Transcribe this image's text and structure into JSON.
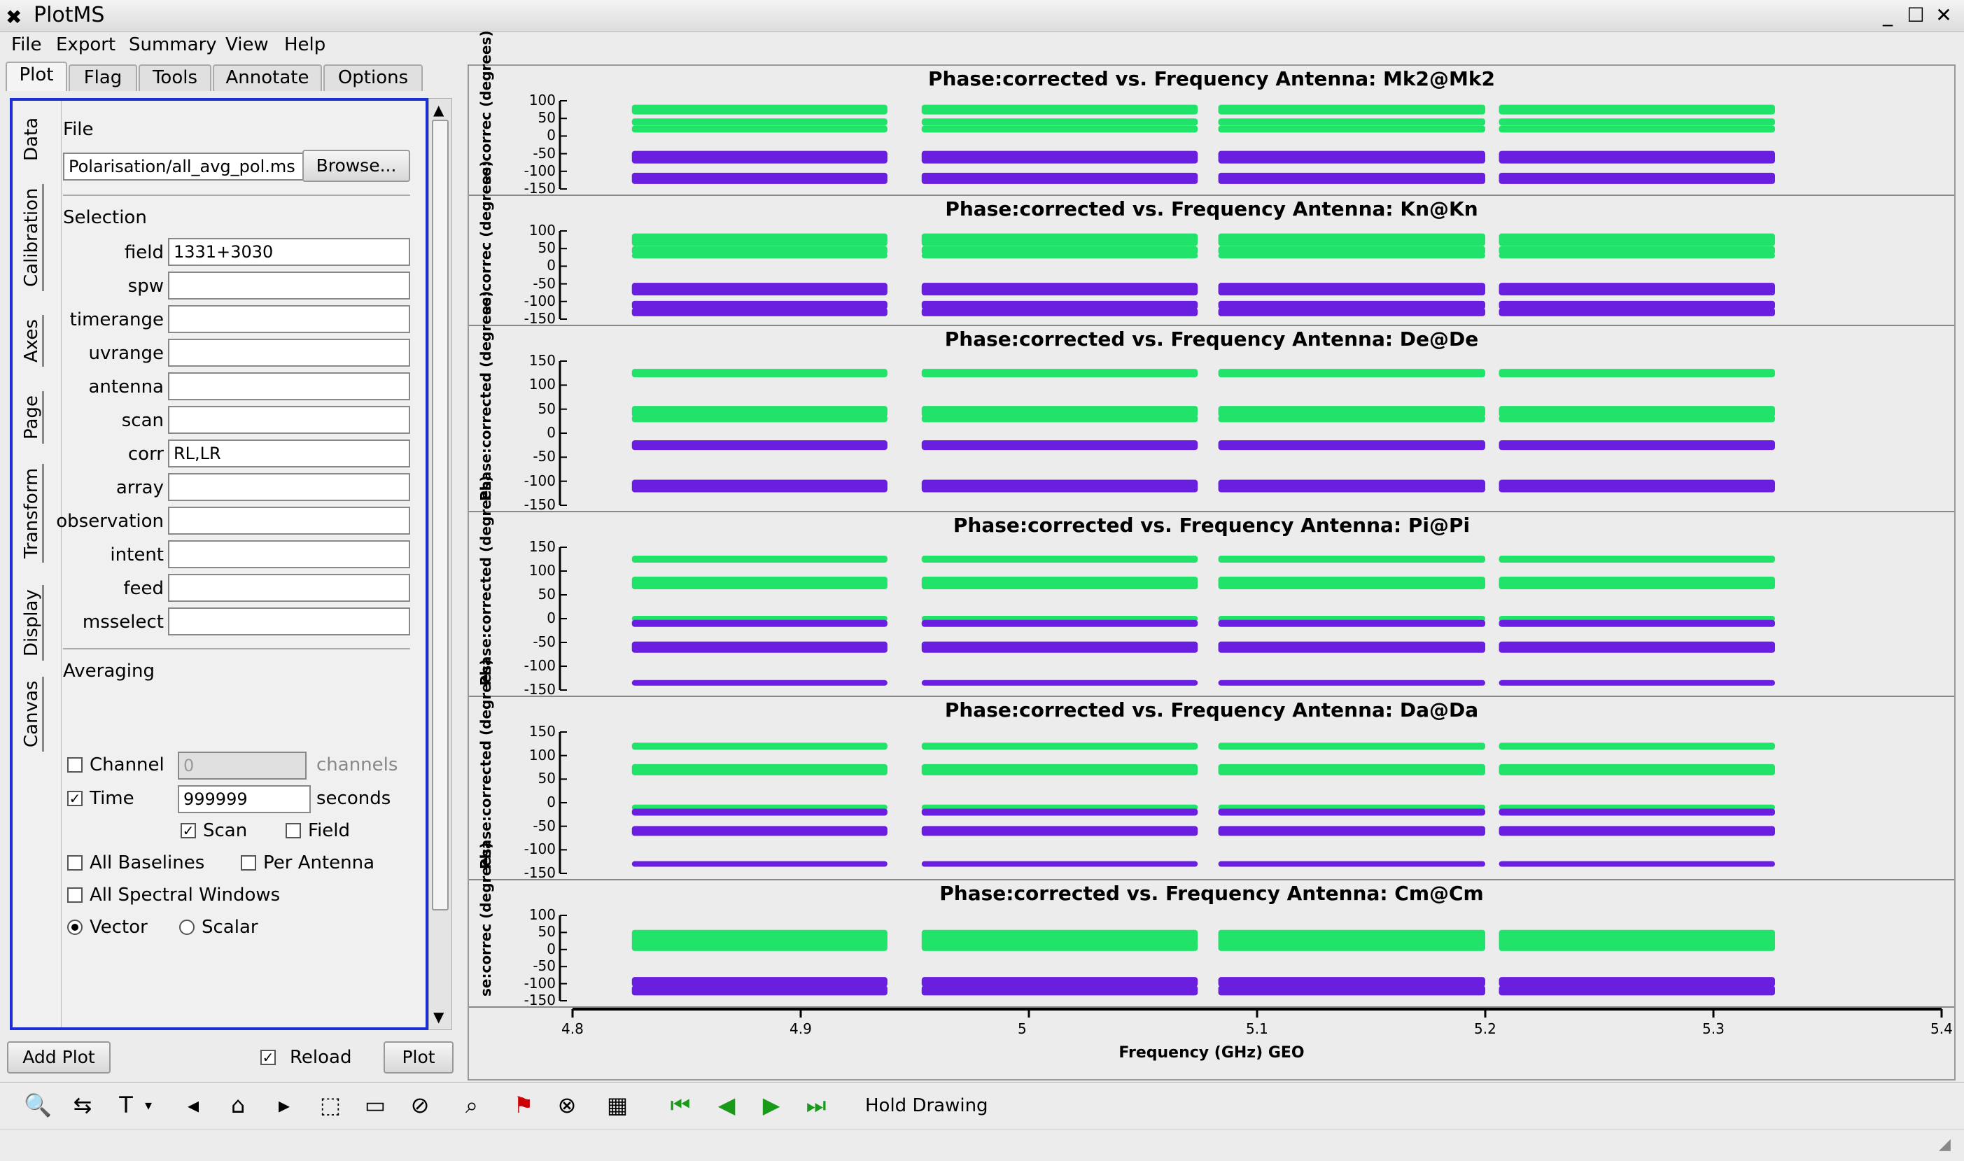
{
  "window": {
    "title": "PlotMS",
    "app_icon": "x-logo-icon"
  },
  "menubar": {
    "items": [
      "File",
      "Export",
      "Summary",
      "View",
      "Help"
    ]
  },
  "top_tabs": [
    "Plot",
    "Flag",
    "Tools",
    "Annotate",
    "Options"
  ],
  "side_tabs": [
    "Data",
    "Calibration",
    "Axes",
    "Page",
    "Transform",
    "Display",
    "Canvas"
  ],
  "data_tab": {
    "file_label": "File",
    "file_value": "Polarisation/all_avg_pol.ms",
    "browse_label": "Browse...",
    "selection_label": "Selection",
    "fields": [
      {
        "label": "field",
        "value": "1331+3030"
      },
      {
        "label": "spw",
        "value": ""
      },
      {
        "label": "timerange",
        "value": ""
      },
      {
        "label": "uvrange",
        "value": ""
      },
      {
        "label": "antenna",
        "value": ""
      },
      {
        "label": "scan",
        "value": ""
      },
      {
        "label": "corr",
        "value": "RL,LR"
      },
      {
        "label": "array",
        "value": ""
      },
      {
        "label": "observation",
        "value": ""
      },
      {
        "label": "intent",
        "value": ""
      },
      {
        "label": "feed",
        "value": ""
      },
      {
        "label": "msselect",
        "value": ""
      }
    ],
    "averaging_label": "Averaging",
    "channel_label": "Channel",
    "channel_value": "0",
    "channel_unit": "channels",
    "time_label": "Time",
    "time_value": "999999",
    "time_unit": "seconds",
    "scan_label": "Scan",
    "field_label": "Field",
    "all_baselines_label": "All Baselines",
    "per_antenna_label": "Per Antenna",
    "all_spw_label": "All Spectral Windows",
    "vector_label": "Vector",
    "scalar_label": "Scalar"
  },
  "bottom_buttons": {
    "add_plot": "Add Plot",
    "reload": "Reload",
    "plot": "Plot"
  },
  "toolbar": {
    "hold_drawing": "Hold Drawing"
  },
  "colors": {
    "green": "#22e36a",
    "purple": "#6a1fe0",
    "selection_border": "#1a2fd6"
  },
  "chart_data": [
    {
      "type": "scatter",
      "title": "Phase:corrected vs. Frequency Antenna: Mk2@Mk2",
      "ylabel": "se:correc (degrees)",
      "yticks": [
        100,
        50,
        0,
        -50,
        -100,
        -150
      ],
      "ylim": [
        -150,
        100
      ]
    },
    {
      "type": "scatter",
      "title": "Phase:corrected vs. Frequency Antenna: Kn@Kn",
      "ylabel": "se:correc (degrees)",
      "yticks": [
        100,
        50,
        0,
        -50,
        -100,
        -150
      ],
      "ylim": [
        -150,
        100
      ]
    },
    {
      "type": "scatter",
      "title": "Phase:corrected vs. Frequency Antenna: De@De",
      "ylabel": "Phase:corrected (degrees)",
      "yticks": [
        150,
        100,
        50,
        0,
        -50,
        -100,
        -150
      ],
      "ylim": [
        -150,
        150
      ]
    },
    {
      "type": "scatter",
      "title": "Phase:corrected vs. Frequency Antenna: Pi@Pi",
      "ylabel": "Phase:corrected (degrees)",
      "yticks": [
        150,
        100,
        50,
        0,
        -50,
        -100,
        -150
      ],
      "ylim": [
        -150,
        150
      ]
    },
    {
      "type": "scatter",
      "title": "Phase:corrected vs. Frequency Antenna: Da@Da",
      "ylabel": "Phase:corrected (degrees)",
      "yticks": [
        150,
        100,
        50,
        0,
        -50,
        -100,
        -150
      ],
      "ylim": [
        -150,
        150
      ]
    },
    {
      "type": "scatter",
      "title": "Phase:corrected vs. Frequency Antenna: Cm@Cm",
      "ylabel": "se:correc (degrees)",
      "yticks": [
        100,
        50,
        0,
        -50,
        -100,
        -150
      ],
      "ylim": [
        -150,
        100
      ]
    }
  ],
  "x_axis": {
    "label": "Frequency (GHz) GEO",
    "ticks": [
      "4.8",
      "4.9",
      "5",
      "5.1",
      "5.2",
      "5.3",
      "5.4"
    ],
    "xlim": [
      4.8,
      5.4
    ]
  }
}
